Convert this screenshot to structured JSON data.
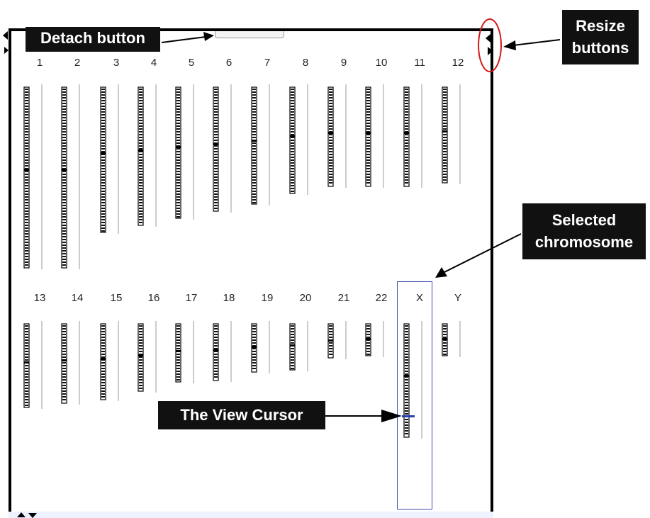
{
  "row1_labels": [
    "1",
    "2",
    "3",
    "4",
    "5",
    "6",
    "7",
    "8",
    "9",
    "10",
    "11",
    "12"
  ],
  "row2_labels": [
    "13",
    "14",
    "15",
    "16",
    "17",
    "18",
    "19",
    "20",
    "21",
    "22",
    "X",
    "Y"
  ],
  "callouts": {
    "detach": "Detach button",
    "resize_line1": "Resize",
    "resize_line2": "buttons",
    "selected_line1": "Selected",
    "selected_line2": "chromosome",
    "view_cursor": "The View Cursor"
  },
  "colors": {
    "selection_box": "#3a4ea8",
    "cursor": "#2a3fb0",
    "resize_circle": "#d11a1a"
  }
}
